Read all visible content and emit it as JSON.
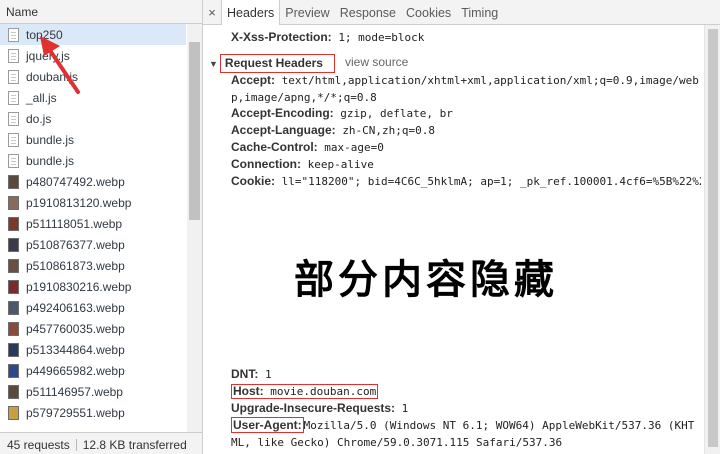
{
  "list": {
    "header": "Name",
    "items": [
      {
        "name": "top250",
        "type": "doc",
        "selected": true
      },
      {
        "name": "jquery.js",
        "type": "doc"
      },
      {
        "name": "douban.js",
        "type": "doc"
      },
      {
        "name": "_all.js",
        "type": "doc"
      },
      {
        "name": "do.js",
        "type": "doc"
      },
      {
        "name": "bundle.js",
        "type": "doc"
      },
      {
        "name": "bundle.js",
        "type": "doc"
      },
      {
        "name": "p480747492.webp",
        "type": "img",
        "color": "#5b4a3a"
      },
      {
        "name": "p1910813120.webp",
        "type": "img",
        "color": "#8a6a5a"
      },
      {
        "name": "p511118051.webp",
        "type": "img",
        "color": "#7a3a2a"
      },
      {
        "name": "p510876377.webp",
        "type": "img",
        "color": "#3a3a4a"
      },
      {
        "name": "p510861873.webp",
        "type": "img",
        "color": "#6a5040"
      },
      {
        "name": "p1910830216.webp",
        "type": "img",
        "color": "#7a2a2a"
      },
      {
        "name": "p492406163.webp",
        "type": "img",
        "color": "#4a5a6a"
      },
      {
        "name": "p457760035.webp",
        "type": "img",
        "color": "#8a4a3a"
      },
      {
        "name": "p513344864.webp",
        "type": "img",
        "color": "#2a3a5a"
      },
      {
        "name": "p449665982.webp",
        "type": "img",
        "color": "#2a4a8a"
      },
      {
        "name": "p511146957.webp",
        "type": "img",
        "color": "#5a4a3a"
      },
      {
        "name": "p579729551.webp",
        "type": "img",
        "color": "#c8a040"
      }
    ],
    "status": {
      "requests": "45 requests",
      "transferred": "12.8 KB transferred"
    }
  },
  "tabs": {
    "close": "×",
    "items": [
      "Headers",
      "Preview",
      "Response",
      "Cookies",
      "Timing"
    ],
    "active": 0
  },
  "headers": {
    "xss": {
      "key": "X-Xss-Protection:",
      "value": "1; mode=block"
    },
    "request_title": "Request Headers",
    "view_source": "view source",
    "accept": {
      "key": "Accept:",
      "value": "text/html,application/xhtml+xml,application/xml;q=0.9,image/webp,image/apng,*/*;q=0.8"
    },
    "accept_encoding": {
      "key": "Accept-Encoding:",
      "value": "gzip, deflate, br"
    },
    "accept_language": {
      "key": "Accept-Language:",
      "value": "zh-CN,zh;q=0.8"
    },
    "cache_control": {
      "key": "Cache-Control:",
      "value": "max-age=0"
    },
    "connection": {
      "key": "Connection:",
      "value": "keep-alive"
    },
    "cookie": {
      "key": "Cookie:",
      "value": "ll=\"118200\"; bid=4C6C_5hklmA; ap=1; _pk_ref.100001.4cf6=%5B%22%2"
    },
    "hidden_note": "部分内容隐藏",
    "dnt": {
      "key": "DNT:",
      "value": "1"
    },
    "host": {
      "key": "Host:",
      "value": "movie.douban.com"
    },
    "upgrade": {
      "key": "Upgrade-Insecure-Requests:",
      "value": "1"
    },
    "user_agent": {
      "key": "User-Agent:",
      "value": "Mozilla/5.0 (Windows NT 6.1; WOW64) AppleWebKit/537.36 (KHTML, like Gecko) Chrome/59.0.3071.115 Safari/537.36"
    }
  },
  "colors": {
    "annotation": "#e03030",
    "selected_row": "#dbe8f8"
  }
}
